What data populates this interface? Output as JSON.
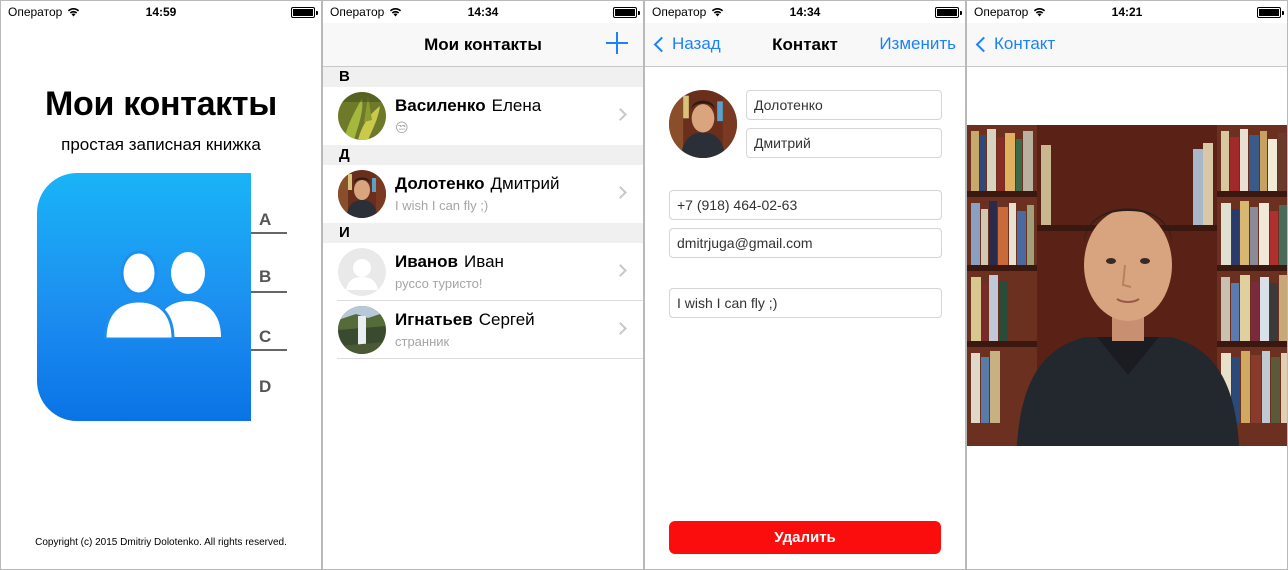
{
  "status": {
    "carrier": "Оператор",
    "times": [
      "14:59",
      "14:34",
      "14:34",
      "14:21"
    ]
  },
  "splash": {
    "title": "Мои контакты",
    "subtitle": "простая записная книжка",
    "tabs": [
      "A",
      "B",
      "C",
      "D"
    ],
    "copyright": "Copyright (c) 2015 Dmitriy Dolotenko. All rights reserved.",
    "book_color": "#1c8ef0"
  },
  "list_screen": {
    "title": "Мои контакты",
    "add_icon": "plus-icon",
    "sections": [
      {
        "letter": "В",
        "rows": [
          {
            "last": "Василенко",
            "first": "Елена",
            "sub": "😒",
            "avatar": "plant-photo"
          }
        ]
      },
      {
        "letter": "Д",
        "rows": [
          {
            "last": "Долотенко",
            "first": "Дмитрий",
            "sub": "I wish I can fly ;)",
            "avatar": "man-photo"
          }
        ]
      },
      {
        "letter": "И",
        "rows": [
          {
            "last": "Иванов",
            "first": "Иван",
            "sub": "руссо туристо!",
            "avatar": "placeholder-avatar"
          },
          {
            "last": "Игнатьев",
            "first": "Сергей",
            "sub": "странник",
            "avatar": "waterfall-photo"
          }
        ]
      }
    ]
  },
  "contact_screen": {
    "back": "Назад",
    "title": "Контакт",
    "edit": "Изменить",
    "last_name": "Долотенко",
    "first_name": "Дмитрий",
    "phone": "+7 (918) 464-02-63",
    "email": "dmitrjuga@gmail.com",
    "note": "I wish I can fly ;)",
    "delete": "Удалить",
    "delete_color": "#fc0d0d"
  },
  "photo_screen": {
    "back": "Контакт"
  },
  "accent": "#1a82fb"
}
